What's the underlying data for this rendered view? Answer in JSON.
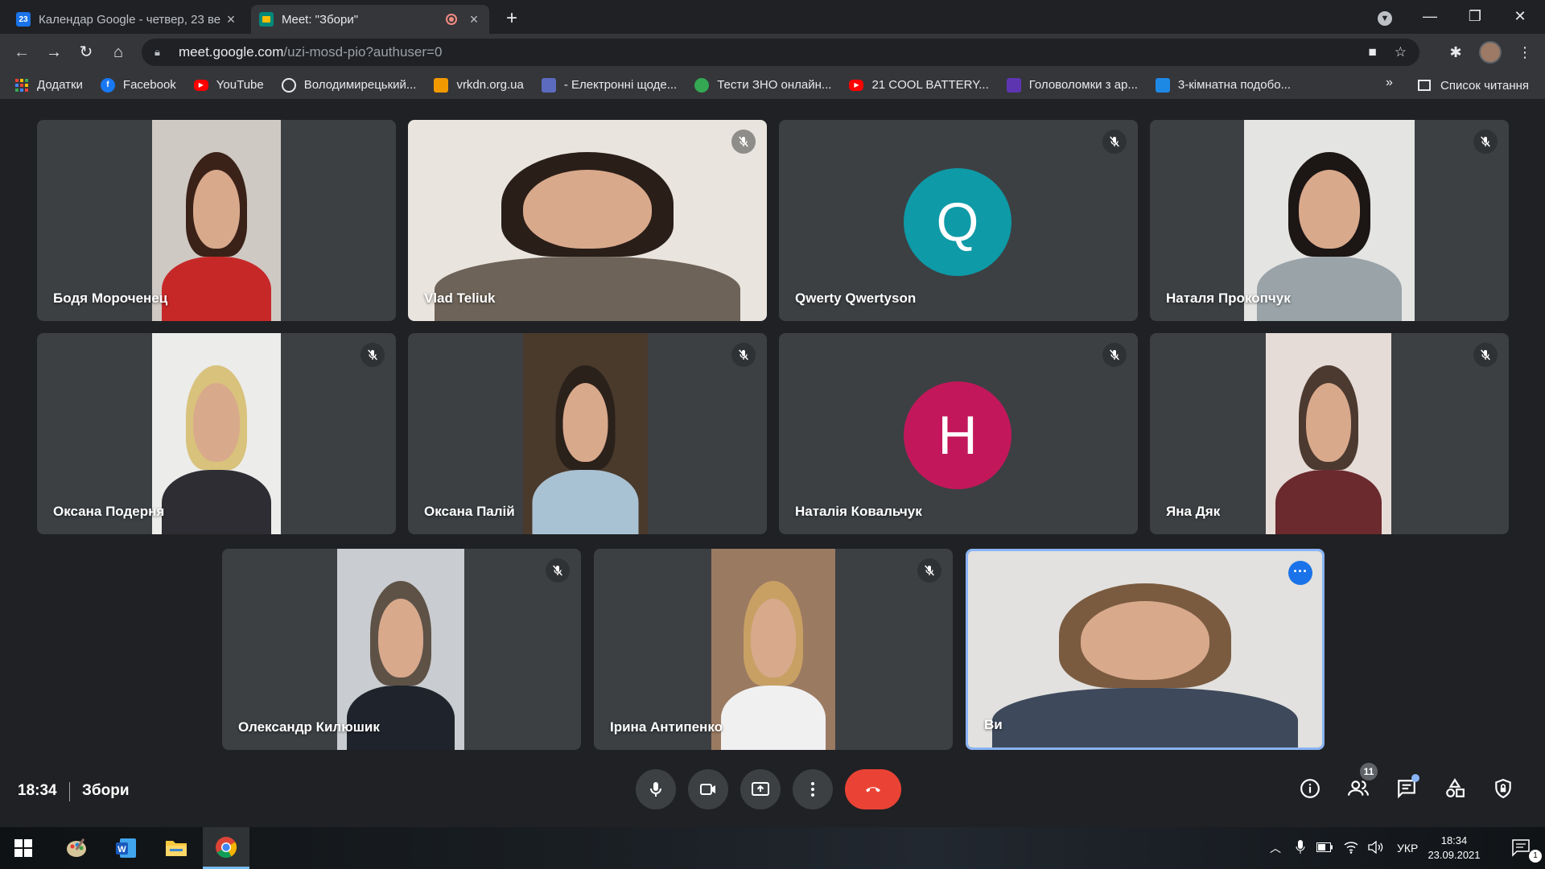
{
  "browser": {
    "tabs": [
      {
        "title": "Календар Google - четвер, 23 ве",
        "favicon": "calendar-icon"
      },
      {
        "title": "Meet: \"Збори\"",
        "favicon": "meet-icon"
      }
    ],
    "url_host": "meet.google.com",
    "url_path": "/uzi-mosd-pio?authuser=0",
    "bookmarks": [
      {
        "label": "Додатки",
        "icon": "apps-grid-icon",
        "color": "#4285f4"
      },
      {
        "label": "Facebook",
        "icon": "facebook-icon",
        "color": "#1877f2"
      },
      {
        "label": "YouTube",
        "icon": "youtube-icon",
        "color": "#ff0000"
      },
      {
        "label": "Володимирецький...",
        "icon": "globe-icon",
        "color": "#e8eaed"
      },
      {
        "label": "vrkdn.org.ua",
        "icon": "site-icon",
        "color": "#f29900"
      },
      {
        "label": "- Електронні щоде...",
        "icon": "diary-icon",
        "color": "#5c6bc0"
      },
      {
        "label": "Тести ЗНО онлайн...",
        "icon": "test-icon",
        "color": "#34a853"
      },
      {
        "label": "21 COOL BATTERY...",
        "icon": "youtube-icon",
        "color": "#ff0000"
      },
      {
        "label": "Головоломки з ар...",
        "icon": "puzzle-icon",
        "color": "#5e35b1"
      },
      {
        "label": "3-кімнатна подобо...",
        "icon": "home-icon",
        "color": "#1e88e5"
      }
    ],
    "more_bookmarks": "»",
    "reading_list": "Список читання"
  },
  "meet": {
    "participants": [
      {
        "name": "Бодя Мороченец",
        "muted": false,
        "type": "video",
        "shirt": "#c62828",
        "hair": "#3a2218",
        "bg": "#cfc9c3"
      },
      {
        "name": "Vlad Teliuk",
        "muted": true,
        "type": "video",
        "shirt": "#6d6358",
        "hair": "#2a1e18",
        "bg": "#e9e5de"
      },
      {
        "name": "Qwerty Qwertyson",
        "muted": true,
        "type": "letter",
        "letter": "Q",
        "color": "#0e9aa7"
      },
      {
        "name": "Наталя Прокопчук",
        "muted": true,
        "type": "video",
        "shirt": "#9aa3a8",
        "hair": "#1c1614",
        "bg": "#e4e4e2"
      },
      {
        "name": "Оксана Подерня",
        "muted": true,
        "type": "video",
        "shirt": "#2d2d33",
        "hair": "#d8c27c",
        "bg": "#ececea"
      },
      {
        "name": "Оксана Палій",
        "muted": true,
        "type": "video",
        "shirt": "#a9c2d3",
        "hair": "#2b211b",
        "bg": "#4a3a2c"
      },
      {
        "name": "Наталія Ковальчук",
        "muted": true,
        "type": "letter",
        "letter": "H",
        "color": "#c2185b"
      },
      {
        "name": "Яна Дяк",
        "muted": true,
        "type": "video",
        "shirt": "#6b2a2e",
        "hair": "#4c3a30",
        "bg": "#e6dcd7"
      },
      {
        "name": "Олександр Килюшик",
        "muted": true,
        "type": "video",
        "shirt": "#1f242c",
        "hair": "#5e5247",
        "bg": "#c9ccd0"
      },
      {
        "name": "Ірина Антипенко",
        "muted": true,
        "type": "video",
        "shirt": "#f0f0f0",
        "hair": "#c8a064",
        "bg": "#9b7a62"
      },
      {
        "name": "Ви",
        "muted": false,
        "type": "self",
        "shirt": "#3e4a5c",
        "hair": "#7a5b40",
        "bg": "#e2e1df"
      }
    ],
    "time": "18:34",
    "meeting_name": "Збори",
    "people_count": "11"
  },
  "taskbar": {
    "language": "УКР",
    "time": "18:34",
    "date": "23.09.2021",
    "notifications": "1"
  }
}
